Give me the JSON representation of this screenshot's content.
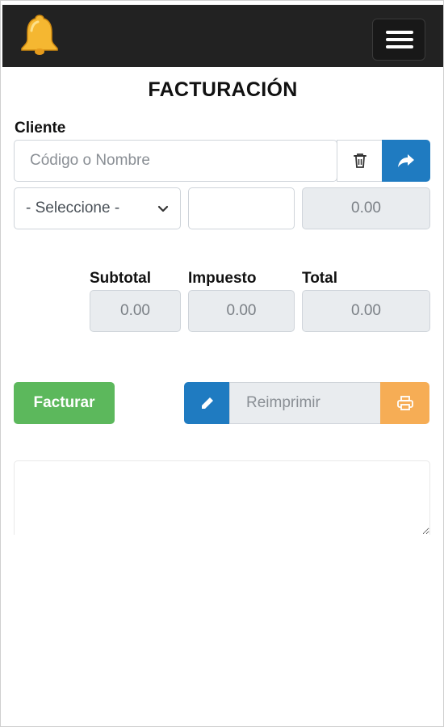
{
  "app": {
    "logo_icon": "bell-icon",
    "menu_icon": "hamburger-menu-icon"
  },
  "page": {
    "title": "FACTURACIÓN"
  },
  "client": {
    "label": "Cliente",
    "search_placeholder": "Código o Nombre",
    "search_value": "",
    "delete_icon": "trash-icon",
    "go_icon": "share-arrow-icon",
    "select_value": "- Seleccione -",
    "extra_value": "",
    "amount_value": "0.00"
  },
  "totals": {
    "subtotal_label": "Subtotal",
    "subtotal_value": "0.00",
    "tax_label": "Impuesto",
    "tax_value": "0.00",
    "total_label": "Total",
    "total_value": "0.00"
  },
  "actions": {
    "invoice_label": "Facturar",
    "reprint_placeholder": "Reimprimir",
    "edit_icon": "pencil-icon",
    "print_icon": "printer-icon"
  },
  "notes": {
    "value": ""
  },
  "colors": {
    "navbar": "#222222",
    "primary": "#1f7bc1",
    "success": "#5cb85c",
    "warning": "#f6ad55",
    "bell": "#f5b731"
  }
}
